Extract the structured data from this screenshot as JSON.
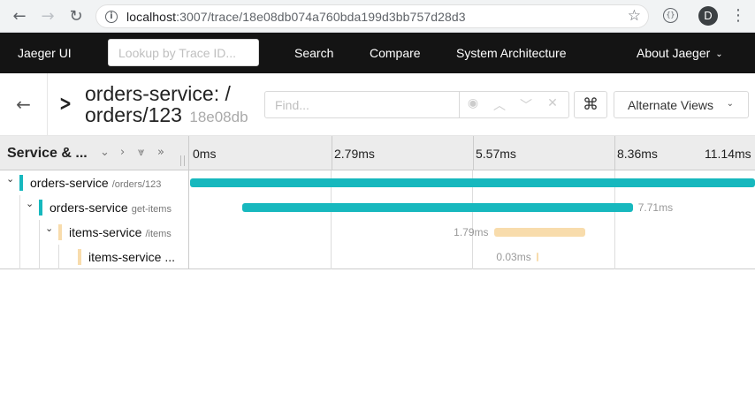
{
  "browser": {
    "url_host": "localhost",
    "url_path": ":3007/trace/18e08db074a760bda199d3bb757d28d3",
    "avatar_letter": "D"
  },
  "nav": {
    "brand": "Jaeger UI",
    "lookup_placeholder": "Lookup by Trace ID...",
    "search": "Search",
    "compare": "Compare",
    "system_architecture": "System Architecture",
    "about": "About Jaeger"
  },
  "trace": {
    "title_line1": "orders-service: /",
    "title_line2": "orders/123",
    "trace_id_short": "18e08db",
    "find_placeholder": "Find...",
    "alternate_views": "Alternate Views"
  },
  "timeline": {
    "column_title": "Service & ...",
    "ticks": [
      "0ms",
      "2.79ms",
      "5.57ms",
      "8.36ms",
      "11.14ms"
    ]
  },
  "spans": [
    {
      "service": "orders-service",
      "operation": "/orders/123",
      "depth": 0,
      "has_children": true,
      "color": "#17b8be",
      "start_ms": 0.0,
      "duration_ms": 11.14,
      "duration_label": ""
    },
    {
      "service": "orders-service",
      "operation": "get-items",
      "depth": 1,
      "has_children": true,
      "color": "#17b8be",
      "start_ms": 1.02,
      "duration_ms": 7.71,
      "duration_label": "7.71ms"
    },
    {
      "service": "items-service",
      "operation": "/items",
      "depth": 2,
      "has_children": true,
      "color": "#f8dcac",
      "start_ms": 6.0,
      "duration_ms": 1.79,
      "duration_label": "1.79ms"
    },
    {
      "service": "items-service ...",
      "operation": "",
      "depth": 3,
      "has_children": false,
      "color": "#f8dcac",
      "start_ms": 6.84,
      "duration_ms": 0.03,
      "duration_label": "0.03ms"
    }
  ]
}
